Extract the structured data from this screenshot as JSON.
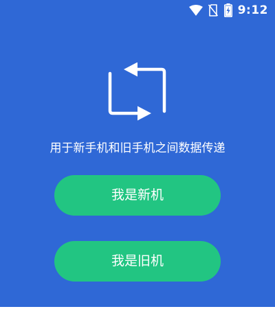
{
  "status_bar": {
    "time": "9:12",
    "icons": [
      "wifi-icon",
      "no-sim-icon",
      "battery-charging-icon"
    ]
  },
  "main": {
    "hero_icon": "transfer-arrows-icon",
    "subtitle": "用于新手机和旧手机之间数据传递",
    "new_phone_button": "我是新机",
    "old_phone_button": "我是旧机"
  },
  "colors": {
    "background": "#2f68d6",
    "button": "#22c582",
    "text": "#ffffff"
  }
}
